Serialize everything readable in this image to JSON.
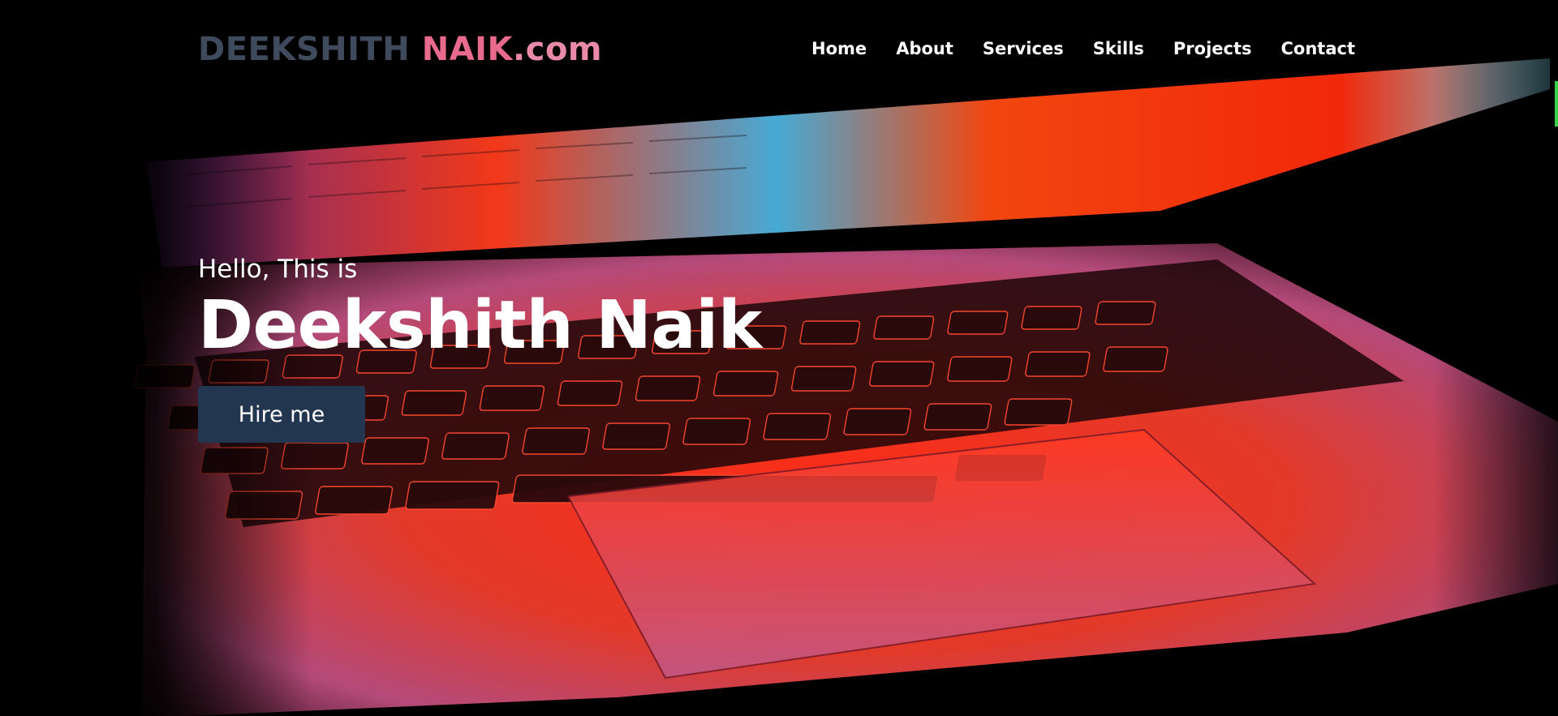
{
  "header": {
    "logo": {
      "first": "DEEKSHITH",
      "last": "NAIK",
      "tld": ".com"
    },
    "nav": [
      {
        "label": "Home"
      },
      {
        "label": "About"
      },
      {
        "label": "Services"
      },
      {
        "label": "Skills"
      },
      {
        "label": "Projects"
      },
      {
        "label": "Contact"
      }
    ]
  },
  "hero": {
    "greeting": "Hello, This is",
    "name": "Deekshith Naik",
    "cta_label": "Hire me",
    "background_image": "laptop-keyboard-photo"
  },
  "colors": {
    "logo_first": "#3f4a5c",
    "logo_last": "#e86a8c",
    "cta_background": "#233650",
    "scroll_indicator": "#3bd14a"
  }
}
